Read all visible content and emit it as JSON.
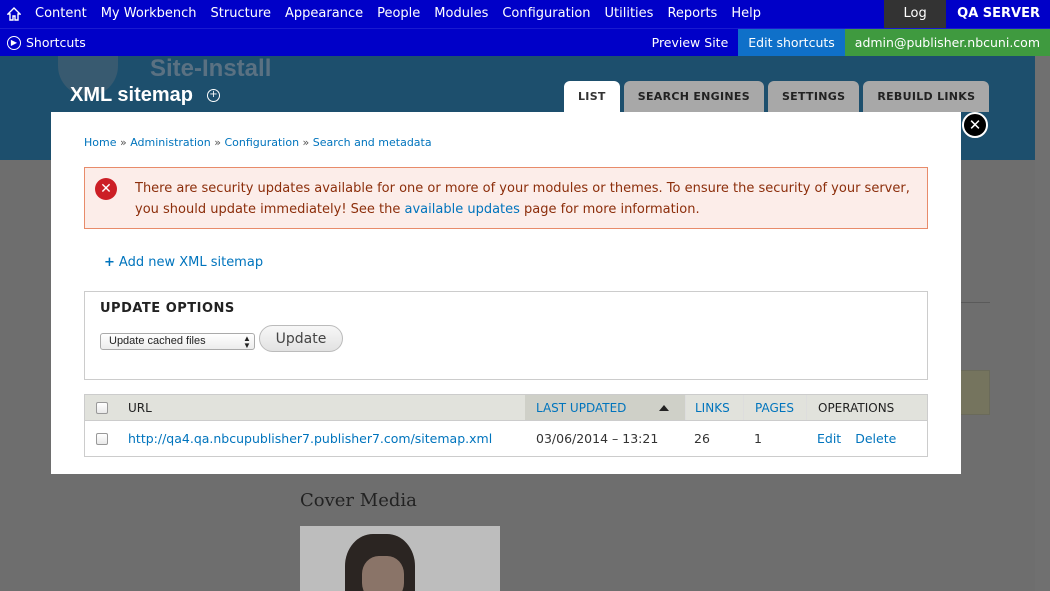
{
  "toolbar": {
    "menu": [
      "Content",
      "My Workbench",
      "Structure",
      "Appearance",
      "People",
      "Modules",
      "Configuration",
      "Utilities",
      "Reports",
      "Help"
    ],
    "logout": "Log out",
    "server": "QA SERVER"
  },
  "shortcuts": {
    "label": "Shortcuts",
    "preview": "Preview Site",
    "edit": "Edit shortcuts",
    "user": "admin@publisher.nbcuni.com"
  },
  "background": {
    "site_name": "Site-Install",
    "page_title": "XML sitemap",
    "cover_media": "Cover Media"
  },
  "tabs": [
    "LIST",
    "SEARCH ENGINES",
    "SETTINGS",
    "REBUILD LINKS"
  ],
  "breadcrumb": [
    "Home",
    "Administration",
    "Configuration",
    "Search and metadata"
  ],
  "breadcrumb_sep": " » ",
  "alert": {
    "text_before": "There are security updates available for one or more of your modules or themes. To ensure the security of your server, you should update immediately! See the ",
    "link": "available updates",
    "text_after": " page for more information."
  },
  "add_link": "Add new XML sitemap",
  "update_options": {
    "legend": "UPDATE OPTIONS",
    "select_value": "Update cached files",
    "button": "Update"
  },
  "table": {
    "headers": {
      "url": "URL",
      "last_updated": "LAST UPDATED",
      "links": "LINKS",
      "pages": "PAGES",
      "operations": "OPERATIONS"
    },
    "rows": [
      {
        "url": "http://qa4.qa.nbcupublisher7.publisher7.com/sitemap.xml",
        "last_updated": "03/06/2014 – 13:21",
        "links": "26",
        "pages": "1",
        "edit": "Edit",
        "delete": "Delete"
      }
    ]
  }
}
